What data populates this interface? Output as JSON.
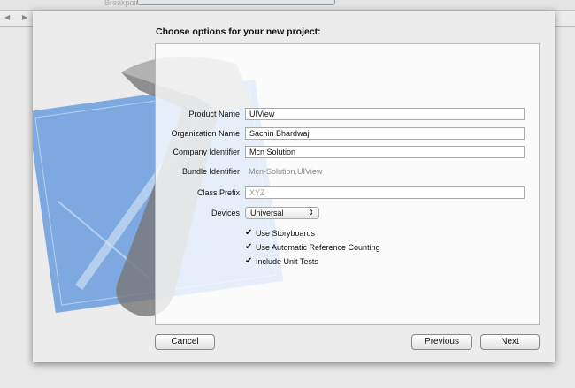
{
  "background": {
    "breakpoints_label": "Breakpoints"
  },
  "dialog": {
    "title": "Choose options for your new project:",
    "fields": [
      {
        "label": "Product Name",
        "value": "UIView"
      },
      {
        "label": "Organization Name",
        "value": "Sachin Bhardwaj"
      },
      {
        "label": "Company Identifier",
        "value": "Mcn Solution"
      }
    ],
    "bundle": {
      "label": "Bundle Identifier",
      "value": "Mcn-Solution.UIView"
    },
    "class_prefix": {
      "label": "Class Prefix",
      "placeholder": "XYZ"
    },
    "devices": {
      "label": "Devices",
      "value": "Universal"
    },
    "checkboxes": [
      {
        "label": "Use Storyboards",
        "checked": true
      },
      {
        "label": "Use Automatic Reference Counting",
        "checked": true
      },
      {
        "label": "Include Unit Tests",
        "checked": true
      }
    ],
    "buttons": {
      "cancel": "Cancel",
      "previous": "Previous",
      "next": "Next"
    }
  }
}
